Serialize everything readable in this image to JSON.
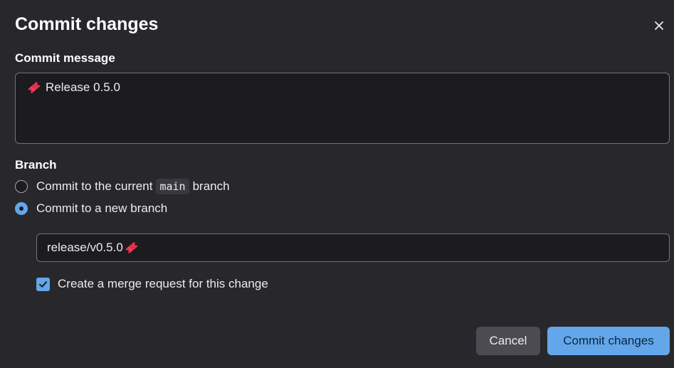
{
  "modal": {
    "title": "Commit changes",
    "close_icon": "close-icon"
  },
  "commit_message": {
    "label": "Commit message",
    "emoji_icon": "ticket-emoji-icon",
    "value": "Release 0.5.0"
  },
  "branch": {
    "label": "Branch",
    "option_current": {
      "prefix": "Commit to the current",
      "branch_name": "main",
      "suffix": "branch",
      "selected": false
    },
    "option_new": {
      "label": "Commit to a new branch",
      "selected": true
    },
    "new_branch_value": "release/v0.5.0",
    "merge_request": {
      "label": "Create a merge request for this change",
      "checked": true
    }
  },
  "footer": {
    "cancel_label": "Cancel",
    "commit_label": "Commit changes"
  },
  "colors": {
    "background": "#28282c",
    "input_background": "#1c1b20",
    "accent": "#63a6e9",
    "cancel_button": "#4c4b51",
    "emoji": "#e2334a"
  }
}
